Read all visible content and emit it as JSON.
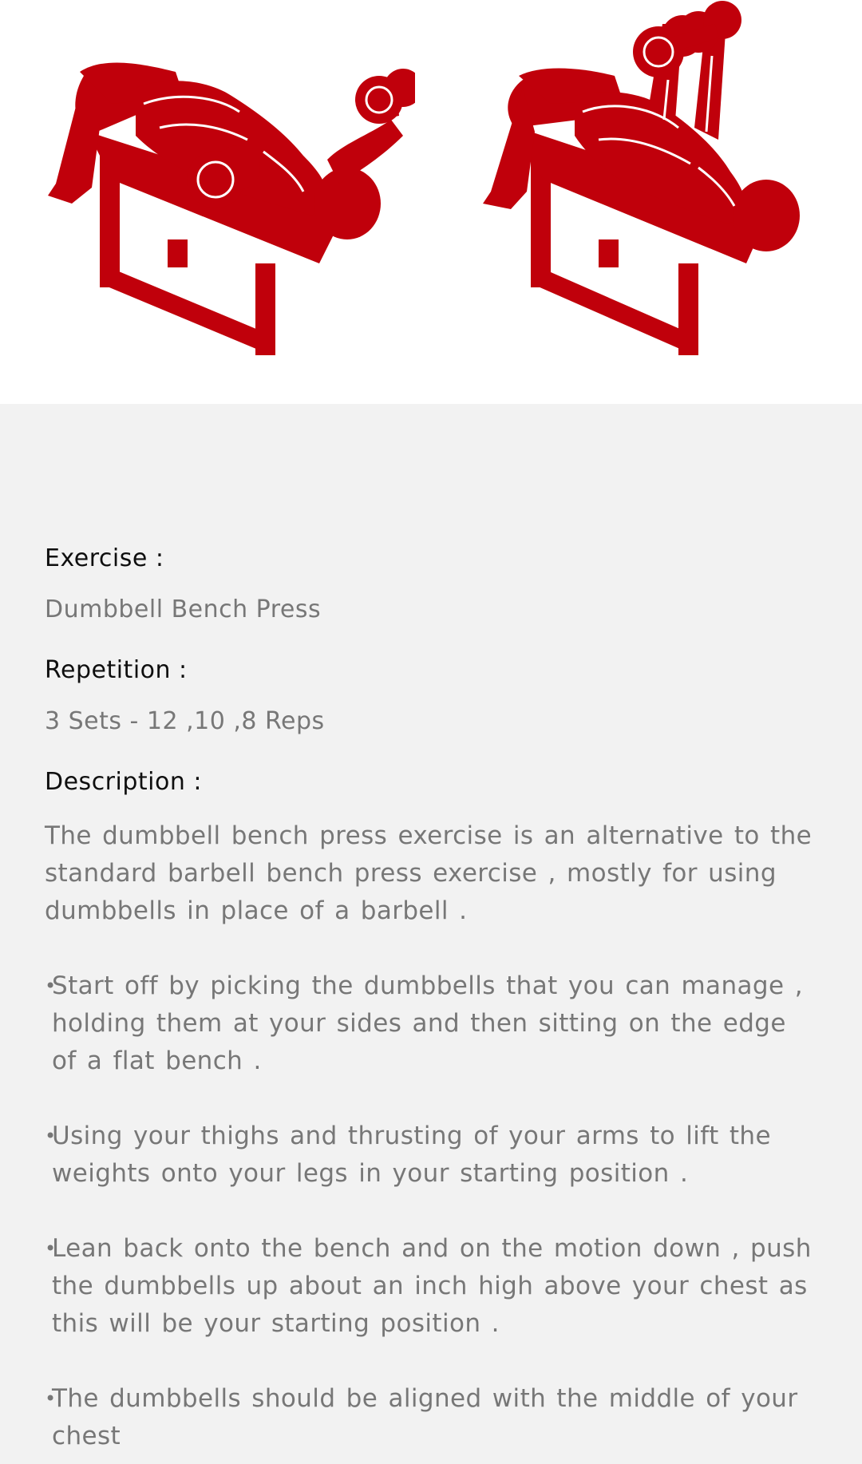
{
  "hero": {
    "illustration_left": "person-bench-press-dumbbells-lowered",
    "illustration_right": "person-bench-press-dumbbells-raised",
    "accent_color": "#c0000b"
  },
  "exercise": {
    "label": "Exercise :",
    "value": "Dumbbell Bench Press"
  },
  "repetition": {
    "label": "Repetition :",
    "value": "3 Sets - 12 ,10 ,8 Reps"
  },
  "description": {
    "label": "Description :",
    "intro": "The dumbbell bench press exercise is an alternative to the standard barbell bench press exercise , mostly for using dumbbells in place of a barbell .",
    "bullets": [
      "Start off by picking the dumbbells that you can manage , holding them at your sides and then sitting on the edge of a flat bench .",
      "Using your thighs and thrusting of your arms to lift the weights onto your legs in your starting position .",
      "Lean back onto the bench and on the motion down , push the dumbbells up about an inch high above your chest as this will be your starting position .",
      "The dumbbells should be aligned with the middle of your chest"
    ]
  }
}
